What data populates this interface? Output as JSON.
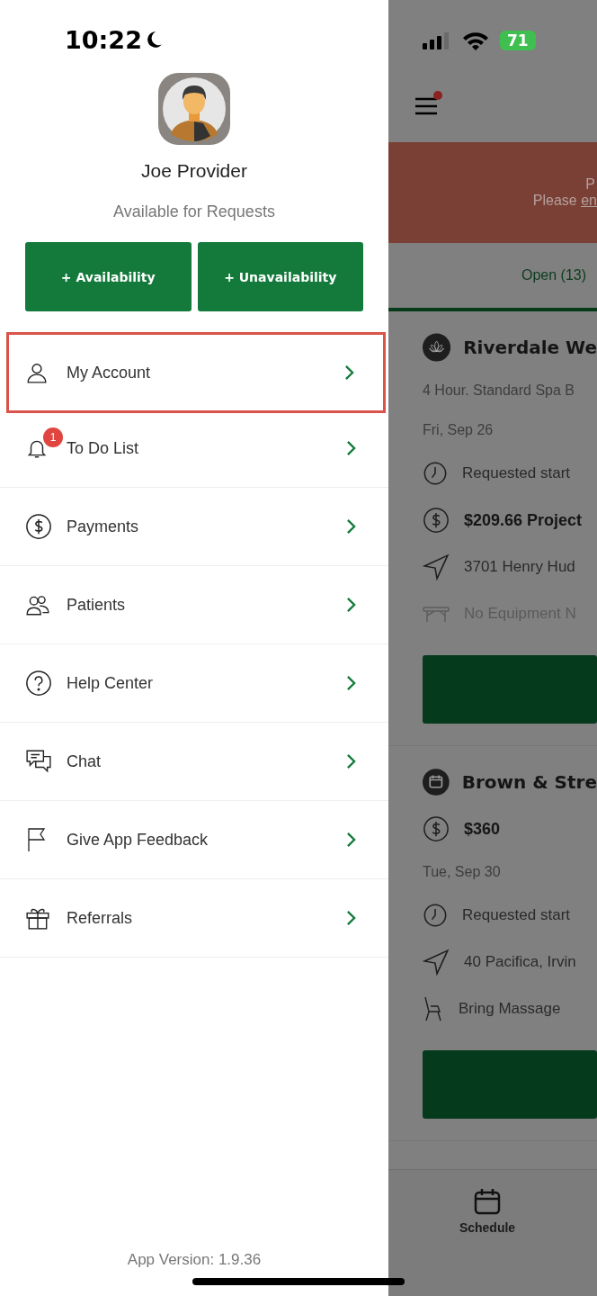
{
  "status_bar": {
    "time": "10:22",
    "battery": "71"
  },
  "profile": {
    "name": "Joe Provider",
    "status": "Available for Requests"
  },
  "actions": [
    "+ Availability",
    "+ Unavailability"
  ],
  "menu": [
    {
      "label": "My Account",
      "kind": "person",
      "highlighted": true
    },
    {
      "label": "To Do List",
      "kind": "bell",
      "badge": "1",
      "highlighted": false
    },
    {
      "label": "Payments",
      "kind": "dollar",
      "highlighted": false
    },
    {
      "label": "Patients",
      "kind": "people",
      "highlighted": false
    },
    {
      "label": "Help Center",
      "kind": "help",
      "highlighted": false
    },
    {
      "label": "Chat",
      "kind": "chat",
      "highlighted": false
    },
    {
      "label": "Give App Feedback",
      "kind": "flag",
      "highlighted": false
    },
    {
      "label": "Referrals",
      "kind": "gift",
      "highlighted": false
    }
  ],
  "app_version": "App Version: 1.9.36",
  "background": {
    "banner": {
      "line_1": "P",
      "line_2": "Please ",
      "link": "en"
    },
    "tab": "Open (13)",
    "cards": [
      {
        "kind": "lotus",
        "title": "Riverdale We",
        "lines": [
          {
            "kind": "text",
            "text": "4 Hour. Standard Spa B"
          },
          {
            "kind": "text",
            "text": "Fri, Sep 26"
          },
          {
            "kind": "clock",
            "text": "Requested start"
          },
          {
            "kind": "dollar",
            "text": "$209.66 Project",
            "bold": true
          },
          {
            "kind": "nav",
            "text": "3701 Henry Hud"
          },
          {
            "kind": "table",
            "text": "No Equipment N",
            "muted": true
          }
        ]
      },
      {
        "kind": "calendar",
        "title": "Brown & Stre",
        "lines": [
          {
            "kind": "dollar",
            "text": "$360",
            "bold": true
          },
          {
            "kind": "text",
            "text": "Tue, Sep 30"
          },
          {
            "kind": "clock",
            "text": "Requested start"
          },
          {
            "kind": "nav",
            "text": "40 Pacifica, Irvin"
          },
          {
            "kind": "chair",
            "text": "Bring Massage"
          }
        ]
      }
    ],
    "nav_tab": "Schedule"
  }
}
